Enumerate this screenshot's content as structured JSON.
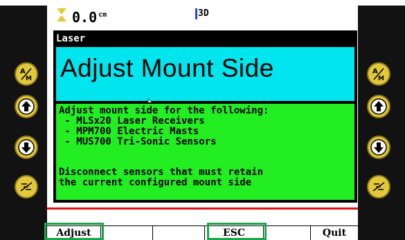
{
  "status": {
    "depth_value": "0.0",
    "depth_unit": "cm",
    "mode": "3D"
  },
  "popup": {
    "title": "Laser",
    "heading": "Adjust Mount Side",
    "body_lines": [
      "Adjust mount side for the following:",
      " - MLSx20 Laser Receivers",
      " - MPM700 Electric Masts",
      " - MUS700 Tri-Sonic Sensors",
      "",
      "Disconnect sensors that must retain",
      "the current configured mount side"
    ]
  },
  "softkeys": [
    "Adjust",
    "",
    "",
    "ESC",
    "",
    "Quit"
  ],
  "side_buttons": {
    "left": [
      "auto-manual-icon",
      "arrow-up-icon",
      "arrow-down-icon",
      "settings-scale-icon"
    ],
    "right": [
      "auto-manual-icon",
      "arrow-up-icon",
      "arrow-down-icon",
      "settings-scale-icon"
    ]
  },
  "colors": {
    "heading_bg": "#00e5ee",
    "body_bg": "#22ee22",
    "button": "#e3c83a",
    "highlight": "#1aa54a",
    "separator": "#e01010"
  }
}
